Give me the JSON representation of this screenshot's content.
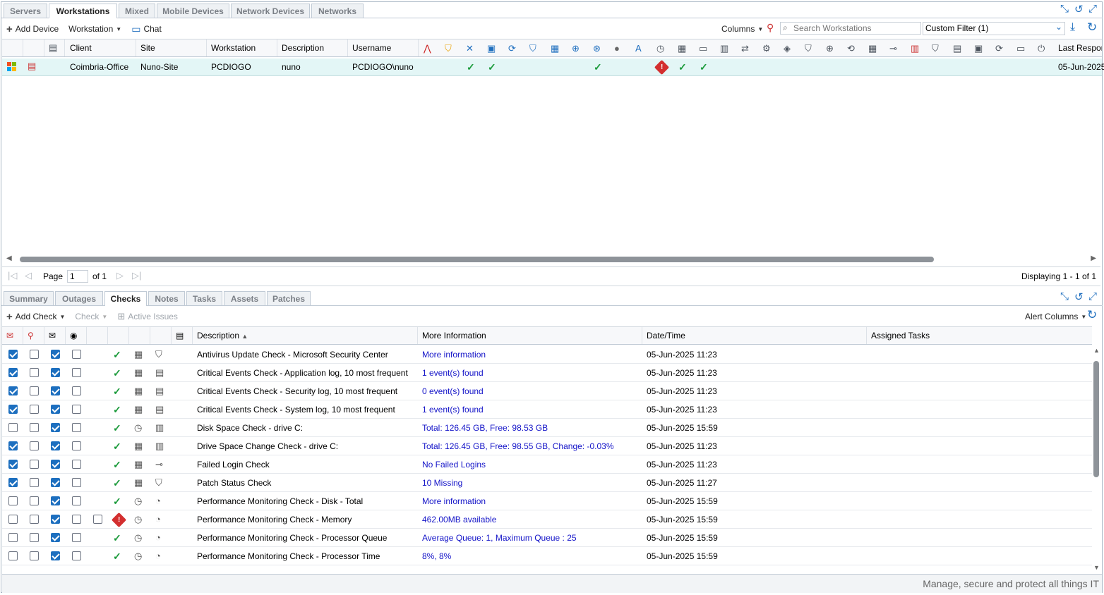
{
  "top_tabs": [
    "Servers",
    "Workstations",
    "Mixed",
    "Mobile Devices",
    "Network Devices",
    "Networks"
  ],
  "top_toolbar": {
    "add_device": "Add Device",
    "workstation": "Workstation",
    "chat": "Chat",
    "columns": "Columns",
    "search_placeholder": "Search Workstations",
    "custom_filter": "Custom Filter (1)"
  },
  "device_columns": [
    "Client",
    "Site",
    "Workstation",
    "Description",
    "Username",
    "Last Respons"
  ],
  "device_row": {
    "client": "Coimbria-Office",
    "site": "Nuno-Site",
    "workstation": "PCDIOGO",
    "description": "nuno",
    "username": "PCDIOGO\\nuno",
    "last_response": "05-Jun-2025"
  },
  "pager": {
    "page_label": "Page",
    "page": "1",
    "of": "of 1",
    "displaying": "Displaying 1 - 1 of 1"
  },
  "bottom_tabs": [
    "Summary",
    "Outages",
    "Checks",
    "Notes",
    "Tasks",
    "Assets",
    "Patches"
  ],
  "checks_toolbar": {
    "add_check": "Add Check",
    "check": "Check",
    "active_issues": "Active Issues",
    "alert_columns": "Alert Columns"
  },
  "check_columns": {
    "description": "Description",
    "more_info": "More Information",
    "datetime": "Date/Time",
    "assigned": "Assigned Tasks"
  },
  "checks": [
    {
      "c1": true,
      "c2": false,
      "c3": true,
      "c4": false,
      "status": "ok",
      "type": "cal",
      "icon": "shield",
      "desc": "Antivirus Update Check - Microsoft Security Center",
      "info": "More information",
      "dt": "05-Jun-2025 11:23"
    },
    {
      "c1": true,
      "c2": false,
      "c3": true,
      "c4": false,
      "status": "ok",
      "type": "cal",
      "icon": "event",
      "desc": "Critical Events Check - Application log, 10 most frequent",
      "info": "1 event(s) found",
      "dt": "05-Jun-2025 11:23"
    },
    {
      "c1": true,
      "c2": false,
      "c3": true,
      "c4": false,
      "status": "ok",
      "type": "cal",
      "icon": "event",
      "desc": "Critical Events Check - Security log, 10 most frequent",
      "info": "0 event(s) found",
      "dt": "05-Jun-2025 11:23"
    },
    {
      "c1": true,
      "c2": false,
      "c3": true,
      "c4": false,
      "status": "ok",
      "type": "cal",
      "icon": "event",
      "desc": "Critical Events Check - System log, 10 most frequent",
      "info": "1 event(s) found",
      "dt": "05-Jun-2025 11:23"
    },
    {
      "c1": false,
      "c2": false,
      "c3": true,
      "c4": false,
      "status": "ok",
      "type": "clock",
      "icon": "disk",
      "desc": "Disk Space Check - drive C:",
      "info": "Total: 126.45 GB, Free: 98.53 GB",
      "dt": "05-Jun-2025 15:59"
    },
    {
      "c1": true,
      "c2": false,
      "c3": true,
      "c4": false,
      "status": "ok",
      "type": "cal",
      "icon": "disk",
      "desc": "Drive Space Change Check - drive C:",
      "info": "Total: 126.45 GB, Free: 98.55 GB, Change: -0.03%",
      "dt": "05-Jun-2025 11:23"
    },
    {
      "c1": true,
      "c2": false,
      "c3": true,
      "c4": false,
      "status": "ok",
      "type": "cal",
      "icon": "key",
      "desc": "Failed Login Check",
      "info": "No Failed Logins",
      "dt": "05-Jun-2025 11:23"
    },
    {
      "c1": true,
      "c2": false,
      "c3": true,
      "c4": false,
      "status": "ok",
      "type": "cal",
      "icon": "shield",
      "desc": "Patch Status Check",
      "info": "10 Missing",
      "dt": "05-Jun-2025 11:27"
    },
    {
      "c1": false,
      "c2": false,
      "c3": true,
      "c4": false,
      "status": "ok",
      "type": "clock",
      "icon": "gauge",
      "desc": "Performance Monitoring Check - Disk - Total",
      "info": "More information",
      "dt": "05-Jun-2025 15:59"
    },
    {
      "c1": false,
      "c2": false,
      "c3": true,
      "c4": false,
      "status": "alert",
      "type": "clock",
      "icon": "gauge",
      "desc": "Performance Monitoring Check - Memory",
      "info": "462.00MB available",
      "dt": "05-Jun-2025 15:59"
    },
    {
      "c1": false,
      "c2": false,
      "c3": true,
      "c4": false,
      "status": "ok",
      "type": "clock",
      "icon": "gauge",
      "desc": "Performance Monitoring Check - Processor Queue",
      "info": "Average Queue: 1, Maximum Queue : 25",
      "dt": "05-Jun-2025 15:59"
    },
    {
      "c1": false,
      "c2": false,
      "c3": true,
      "c4": false,
      "status": "ok",
      "type": "clock",
      "icon": "gauge",
      "desc": "Performance Monitoring Check - Processor Time",
      "info": "8%, 8%",
      "dt": "05-Jun-2025 15:59"
    }
  ],
  "footer": "Manage, secure and protect all things IT"
}
